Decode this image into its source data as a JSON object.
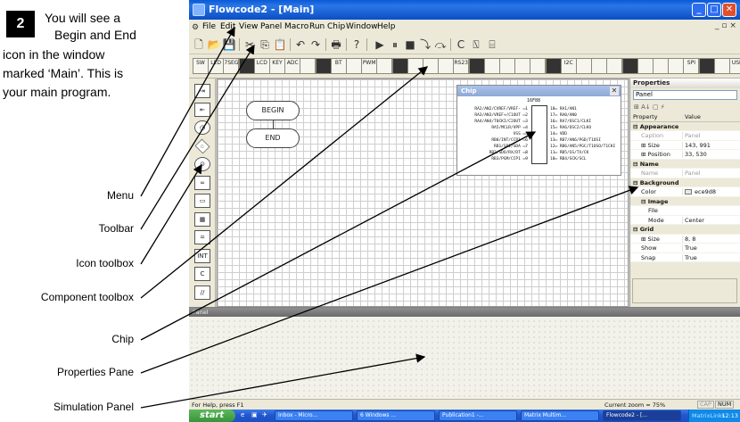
{
  "tutorial": {
    "step_number": "2",
    "lines": [
      "You will see a",
      "Begin and End",
      "icon in the window",
      "marked ‘Main’. This is",
      "your main program."
    ],
    "callouts": {
      "menu": "Menu",
      "toolbar": "Toolbar",
      "icon_toolbox": "Icon toolbox",
      "component_toolbox": "Component toolbox",
      "chip": "Chip",
      "properties_pane": "Properties Pane",
      "simulation_panel": "Simulation Panel"
    }
  },
  "window": {
    "title": "Flowcode2 - [Main]",
    "controls": [
      "_",
      "□",
      "✕"
    ],
    "mdi_controls": "_ ▫ ×"
  },
  "menu": [
    "File",
    "Edit",
    "View",
    "Panel",
    "Macro",
    "Run",
    "Chip",
    "Window",
    "Help"
  ],
  "toolbar": {
    "buttons": [
      "new",
      "open",
      "save",
      "cut",
      "copy",
      "paste",
      "undo",
      "redo",
      "print",
      "help",
      "run",
      "pause",
      "stop",
      "step-into",
      "step-over",
      "watch",
      "c",
      "asm",
      "hex"
    ]
  },
  "component_toolbox": {
    "labels": [
      "SW",
      "LED",
      "7SEG",
      "",
      "LCD",
      "KEY",
      "ADC",
      "",
      "",
      "BT",
      "",
      "PWM",
      "",
      "",
      "",
      "",
      "",
      "RS232",
      "",
      "",
      "",
      "",
      "",
      "",
      "I2C",
      "",
      "",
      "",
      "",
      "",
      "",
      "",
      "SPI",
      "",
      "",
      "USB"
    ]
  },
  "icon_toolbox": {
    "items": [
      "input",
      "output",
      "delay",
      "decision",
      "connection",
      "loop",
      "macro",
      "component-macro",
      "calculation",
      "interrupt",
      "code",
      "comment"
    ]
  },
  "canvas": {
    "begin_label": "BEGIN",
    "end_label": "END"
  },
  "chip": {
    "title": "Chip",
    "close": "✕",
    "model": "16F88",
    "left_pins": [
      {
        "name": "RA2/AN2/CVREF/VREF-",
        "num": "1"
      },
      {
        "name": "RA3/AN3/VREF+/C1OUT",
        "num": "2"
      },
      {
        "name": "RA4/AN4/T0CKI/C2OUT",
        "num": "3"
      },
      {
        "name": "RA5/MCLR/VPP",
        "num": "4"
      },
      {
        "name": "VSS",
        "num": "5"
      },
      {
        "name": "RB0/INT/CCP1",
        "num": "6"
      },
      {
        "name": "RB1/SDI/SDA",
        "num": "7"
      },
      {
        "name": "RB2/SDO/RX/DT",
        "num": "8"
      },
      {
        "name": "RB3/PGM/CCP1",
        "num": "9"
      }
    ],
    "right_pins": [
      {
        "name": "RA1/AN1",
        "num": "18"
      },
      {
        "name": "RA0/AN0",
        "num": "17"
      },
      {
        "name": "RA7/OSC1/CLKI",
        "num": "16"
      },
      {
        "name": "RA6/OSC2/CLKO",
        "num": "15"
      },
      {
        "name": "VDD",
        "num": "14"
      },
      {
        "name": "RB7/AN6/PGD/T1OSI",
        "num": "13"
      },
      {
        "name": "RB6/AN5/PGC/T1OSO/T1CKI",
        "num": "12"
      },
      {
        "name": "RB5/SS/TX/CK",
        "num": "11"
      },
      {
        "name": "RB4/SCK/SCL",
        "num": "10"
      }
    ]
  },
  "properties": {
    "title": "Properties",
    "object": "Panel",
    "tools": "⊞ A↓ ▢ ⚡",
    "column_property": "Property",
    "column_value": "Value",
    "rows": [
      {
        "kind": "cat",
        "name": "Appearance",
        "value": ""
      },
      {
        "kind": "prop",
        "name": "Caption",
        "value": "Panel",
        "grey": true,
        "indent": 1
      },
      {
        "kind": "prop",
        "name": "Size",
        "value": "143, 991",
        "indent": 1,
        "expander": "⊞"
      },
      {
        "kind": "prop",
        "name": "Position",
        "value": "33, 530",
        "indent": 1,
        "expander": "⊞"
      },
      {
        "kind": "cat",
        "name": "Name",
        "value": ""
      },
      {
        "kind": "prop",
        "name": "Name",
        "value": "Panel",
        "grey": true,
        "indent": 1
      },
      {
        "kind": "cat",
        "name": "Background",
        "value": ""
      },
      {
        "kind": "prop",
        "name": "Color",
        "value": "ece9d8",
        "swatch": true,
        "indent": 1
      },
      {
        "kind": "cat",
        "name": "Image",
        "value": "",
        "indent": 1
      },
      {
        "kind": "prop",
        "name": "File",
        "value": "",
        "indent": 2
      },
      {
        "kind": "prop",
        "name": "Mode",
        "value": "Center",
        "indent": 2
      },
      {
        "kind": "cat",
        "name": "Grid",
        "value": ""
      },
      {
        "kind": "prop",
        "name": "Size",
        "value": "8, 8",
        "indent": 1,
        "expander": "⊞"
      },
      {
        "kind": "prop",
        "name": "Show",
        "value": "True",
        "indent": 1
      },
      {
        "kind": "prop",
        "name": "Snap",
        "value": "True",
        "indent": 1
      }
    ]
  },
  "simulation_panel": {
    "title": "Panel"
  },
  "status": {
    "help": "For Help, press F1",
    "zoom": "Current zoom = 75%",
    "caps": "CAP",
    "num": "NUM"
  },
  "taskbar": {
    "start": "start",
    "tasks": [
      {
        "label": "Inbox - Micro...",
        "active": false
      },
      {
        "label": "6 Windows ...",
        "active": false
      },
      {
        "label": "Publication1 -...",
        "active": false
      },
      {
        "label": "Matrix Multim...",
        "active": false
      },
      {
        "label": "Flowcode2 - [...",
        "active": true
      }
    ],
    "tray_text": "MatrixLinks",
    "clock": "12:13"
  },
  "colors": {
    "title_blue": "#0a5ad8",
    "panel_bg": "#ece9d8",
    "start_green": "#38933a"
  }
}
